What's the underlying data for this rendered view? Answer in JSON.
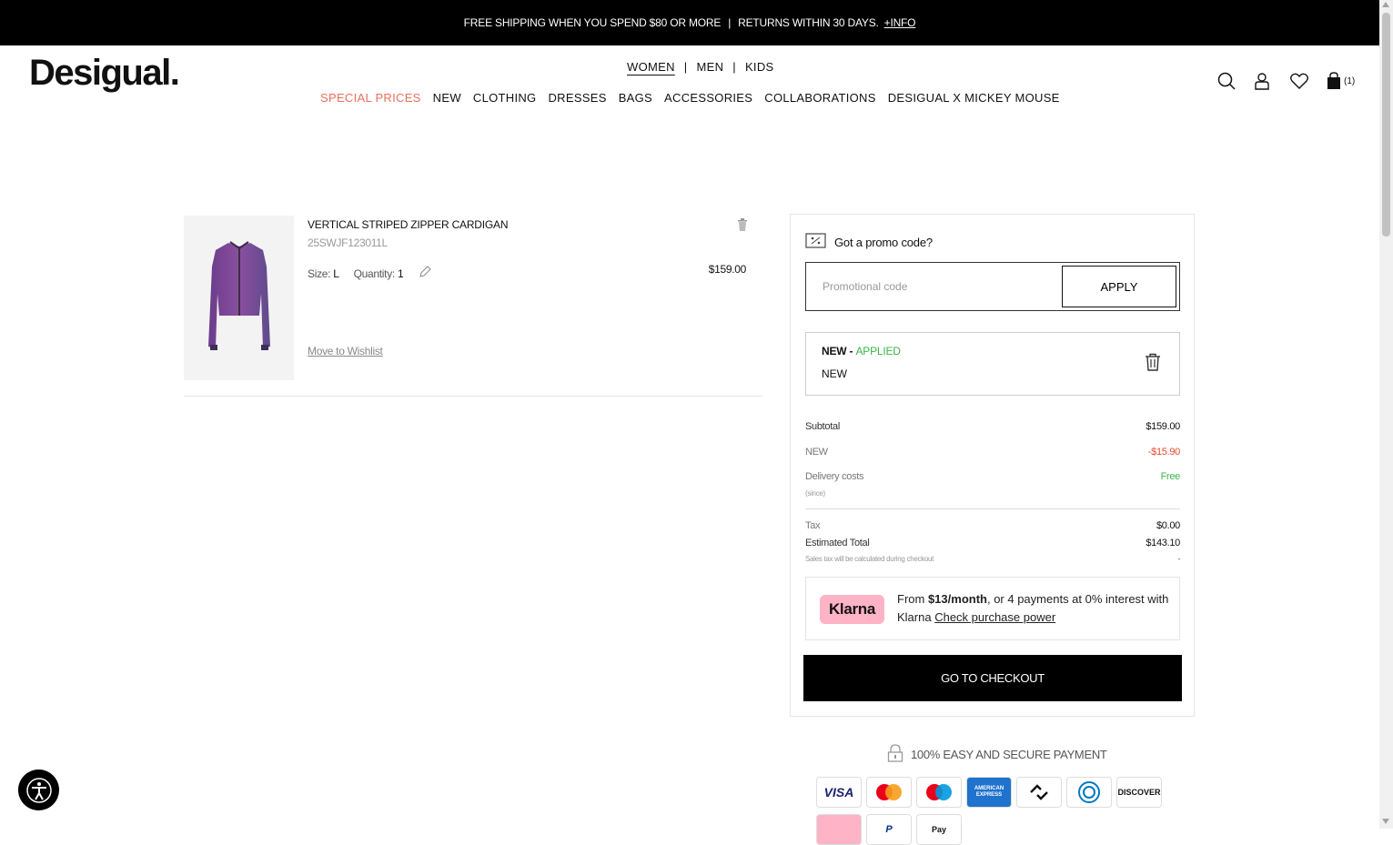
{
  "topbar": {
    "shipping": "FREE SHIPPING WHEN YOU SPEND $80 OR MORE",
    "separator": "|",
    "returns": "RETURNS WITHIN 30 DAYS.",
    "info_link": "+INFO"
  },
  "header": {
    "logo": "Desigual.",
    "gender_nav": [
      {
        "label": "WOMEN",
        "active": true
      },
      {
        "label": "MEN",
        "active": false
      },
      {
        "label": "KIDS",
        "active": false
      }
    ],
    "category_nav": [
      "SPECIAL PRICES",
      "NEW",
      "CLOTHING",
      "DRESSES",
      "BAGS",
      "ACCESSORIES",
      "COLLABORATIONS",
      "DESIGUAL X MICKEY MOUSE"
    ],
    "cart_count": "(1)",
    "icons": [
      "search-icon",
      "account-icon",
      "wishlist-icon",
      "cart-icon"
    ]
  },
  "cart_item": {
    "name": "VERTICAL STRIPED ZIPPER CARDIGAN",
    "sku": "25SWJF123011L",
    "size_label": "Size:",
    "size_value": "L",
    "quantity_label": "Quantity:",
    "quantity_value": "1",
    "price": "$159.00",
    "move_to_wishlist": "Move to Wishlist"
  },
  "summary": {
    "promo_heading": "Got a promo code?",
    "promo_placeholder": "Promotional code",
    "apply_label": "APPLY",
    "applied_code": "NEW - ",
    "applied_status": "APPLIED",
    "applied_sub": "NEW",
    "subtotal_label": "Subtotal",
    "subtotal_value": "$159.00",
    "discount_label": "NEW",
    "discount_value": "-$15.90",
    "delivery_label": "Delivery costs",
    "delivery_value": "Free",
    "delivery_note": "(since)",
    "tax_label": "Tax",
    "tax_value": "$0.00",
    "total_label": "Estimated Total",
    "total_value": "$143.10",
    "tax_note": "Sales tax will be calculated during checkout",
    "tax_note_value": "-",
    "klarna_badge": "Klarna",
    "klarna_from": "From ",
    "klarna_amount": "$13/month",
    "klarna_rest": ", or 4 payments at 0% interest with Klarna ",
    "klarna_link": "Check purchase power",
    "checkout_label": "GO TO CHECKOUT"
  },
  "payment": {
    "secure_text": "100% EASY AND SECURE PAYMENT",
    "cards": [
      "VISA",
      "mastercard",
      "maestro",
      "AMERICAN EXPRESS",
      "afterpay",
      "Diners Club",
      "DISCOVER"
    ],
    "cards_row2": [
      "Klarna",
      "PayPal",
      "Apple Pay"
    ]
  },
  "colors": {
    "sale": "#e8705d",
    "applied": "#3ab54a",
    "discount": "#e8492f",
    "klarna_pink": "#ffb3c7",
    "amex_blue": "#1f72cd"
  }
}
